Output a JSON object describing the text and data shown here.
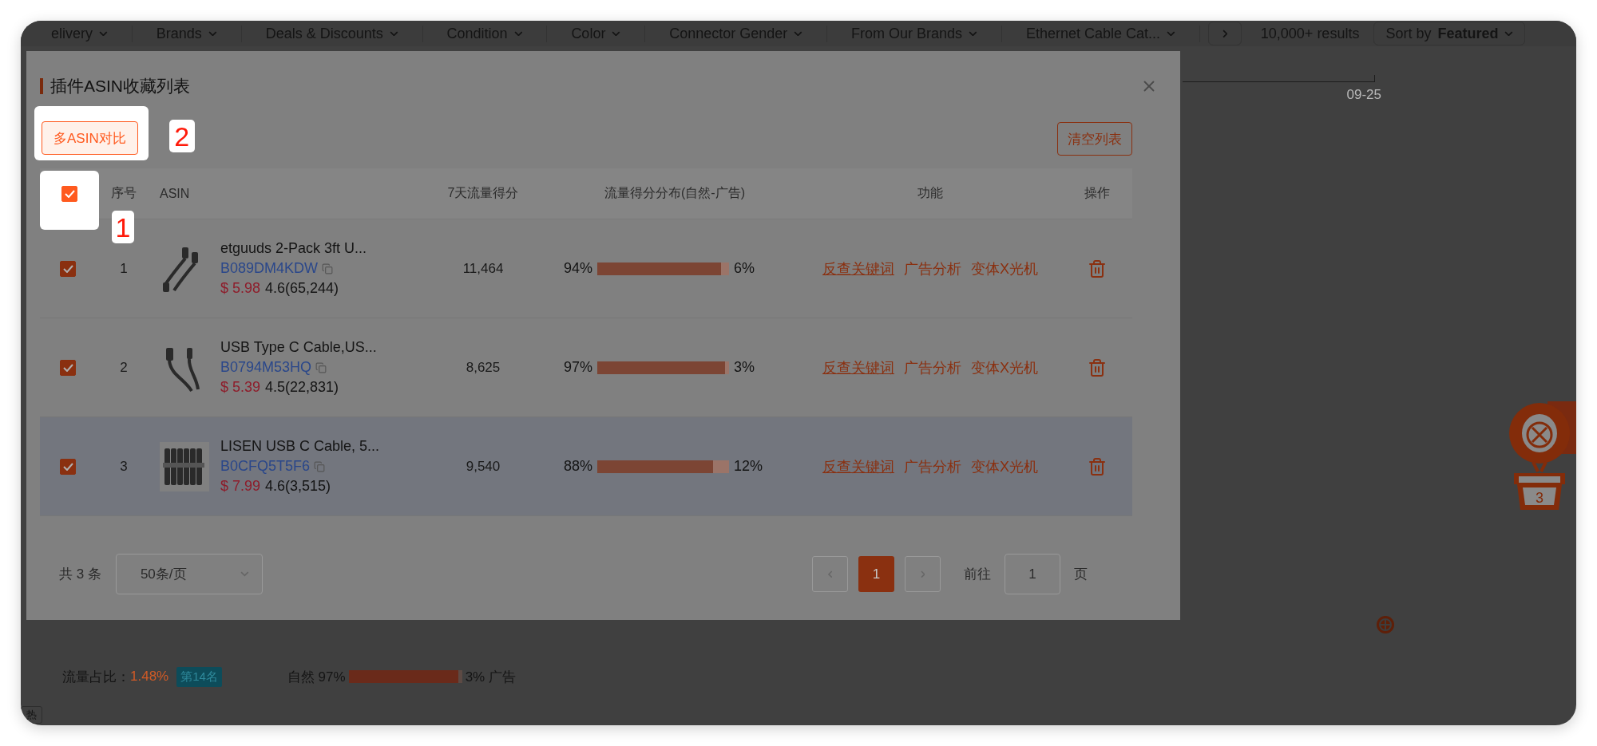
{
  "background": {
    "filters": [
      {
        "label": "elivery"
      },
      {
        "label": "Brands"
      },
      {
        "label": "Deals & Discounts"
      },
      {
        "label": "Condition"
      },
      {
        "label": "Color"
      },
      {
        "label": "Connector Gender"
      },
      {
        "label": "From Our Brands"
      },
      {
        "label": "Ethernet Cable Cat..."
      }
    ],
    "results": "10,000+ results",
    "sort": {
      "label": "Sort by",
      "value": "Featured"
    },
    "timeline_label": "09-25",
    "stats": {
      "share_label": "流量占比：",
      "share_value": "1.48%",
      "rank": "第14名",
      "natural_label": "自然 97%",
      "level": 0.97,
      "ad_label": "3% 广告"
    },
    "corner_tag": "热"
  },
  "modal": {
    "title": "插件ASIN收藏列表",
    "compare_button": "多ASIN对比",
    "clear_button": "清空列表",
    "header_checked": true,
    "columns": [
      "序号",
      "ASIN",
      "7天流量得分",
      "流量得分分布(自然-广告)",
      "功能",
      "操作"
    ],
    "rows": [
      {
        "index": "1",
        "title": "etguuds 2-Pack 3ft U...",
        "asin": "B089DM4KDW",
        "price": "$ 5.98",
        "rating": "4.6(65,244)",
        "score": "11,464",
        "natural": "94%",
        "level": 0.94,
        "ad": "6%",
        "checked": true,
        "highlighted": false,
        "actions": [
          {
            "label": "反查关键词",
            "underlined": true
          },
          {
            "label": "广告分析",
            "underlined": false
          },
          {
            "label": "变体X光机",
            "underlined": false
          }
        ]
      },
      {
        "index": "2",
        "title": "USB Type C Cable,US...",
        "asin": "B0794M53HQ",
        "price": "$ 5.39",
        "rating": "4.5(22,831)",
        "score": "8,625",
        "natural": "97%",
        "level": 0.97,
        "ad": "3%",
        "checked": true,
        "highlighted": false,
        "actions": [
          {
            "label": "反查关键词",
            "underlined": true
          },
          {
            "label": "广告分析",
            "underlined": false
          },
          {
            "label": "变体X光机",
            "underlined": false
          }
        ]
      },
      {
        "index": "3",
        "title": "LISEN USB C Cable, 5...",
        "asin": "B0CFQ5T5F6",
        "price": "$ 7.99",
        "rating": "4.6(3,515)",
        "score": "9,540",
        "natural": "88%",
        "level": 0.88,
        "ad": "12%",
        "checked": true,
        "highlighted": true,
        "actions": [
          {
            "label": "反查关键词",
            "underlined": true
          },
          {
            "label": "广告分析",
            "underlined": false
          },
          {
            "label": "变体X光机",
            "underlined": false
          }
        ]
      }
    ],
    "footer": {
      "total": "共 3 条",
      "page_size": "50条/页",
      "pages": [
        {
          "label": "1",
          "selected": true
        }
      ],
      "goto_label": "前往",
      "goto_value": "1",
      "page_suffix": "页"
    }
  },
  "callouts": [
    {
      "number": "2"
    },
    {
      "number": "1"
    }
  ],
  "widget": {
    "count": "3"
  }
}
